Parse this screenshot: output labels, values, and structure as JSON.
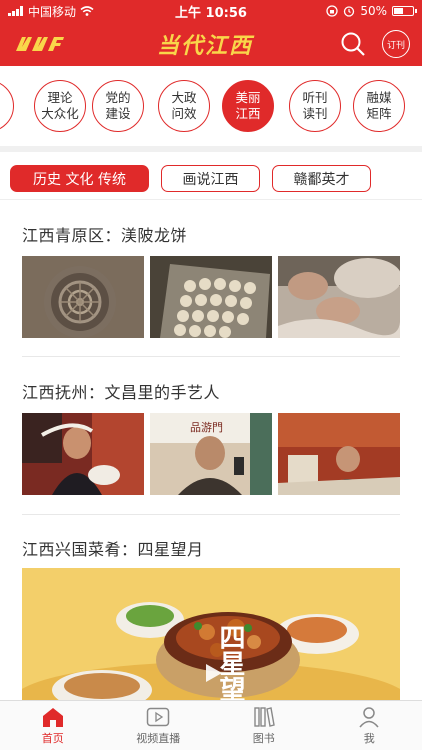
{
  "status_bar": {
    "carrier": "中国移动",
    "time": "上午 10:56",
    "battery": "50%",
    "battery_level": 0.5
  },
  "header": {
    "title": "当代江西",
    "subscribe_label": "订刊",
    "colors": {
      "brand": "#e02a2a",
      "title": "#f9d64a"
    }
  },
  "channels": [
    {
      "label": ""
    },
    {
      "label": "理论\n大众化"
    },
    {
      "label": "党的\n建设"
    },
    {
      "label": "大政\n问效"
    },
    {
      "label": "美丽\n江西",
      "active": true
    },
    {
      "label": "听刊\n读刊"
    },
    {
      "label": "融媒\n矩阵"
    }
  ],
  "tags": [
    {
      "label": "历史 文化 传统",
      "active": true
    },
    {
      "label": "画说江西"
    },
    {
      "label": "赣鄱英才"
    }
  ],
  "articles": [
    {
      "title": "江西青原区：渼陂龙饼"
    },
    {
      "title": "江西抚州：文昌里的手艺人"
    },
    {
      "title": "江西兴国菜肴：四星望月",
      "overlay_text": "四星望"
    }
  ],
  "tabbar": [
    {
      "label": "首页",
      "icon": "home-icon",
      "active": true
    },
    {
      "label": "视频直播",
      "icon": "video-icon"
    },
    {
      "label": "图书",
      "icon": "books-icon"
    },
    {
      "label": "我",
      "icon": "user-icon"
    }
  ]
}
